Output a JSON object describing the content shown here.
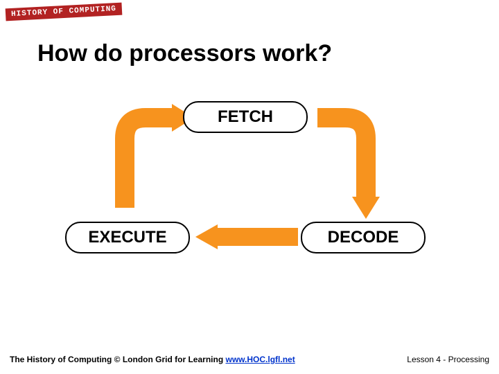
{
  "badge": "HISTORY OF COMPUTING",
  "title": "How do processors work?",
  "cycle": {
    "fetch": "FETCH",
    "decode": "DECODE",
    "execute": "EXECUTE"
  },
  "footer": {
    "credit": "The History of Computing © London Grid for Learning   ",
    "link_text": "www.HOC.lgfl.net",
    "link_href": "http://www.HOC.lgfl.net",
    "lesson": "Lesson 4 - Processing"
  },
  "colors": {
    "arrow": "#f7931e"
  }
}
